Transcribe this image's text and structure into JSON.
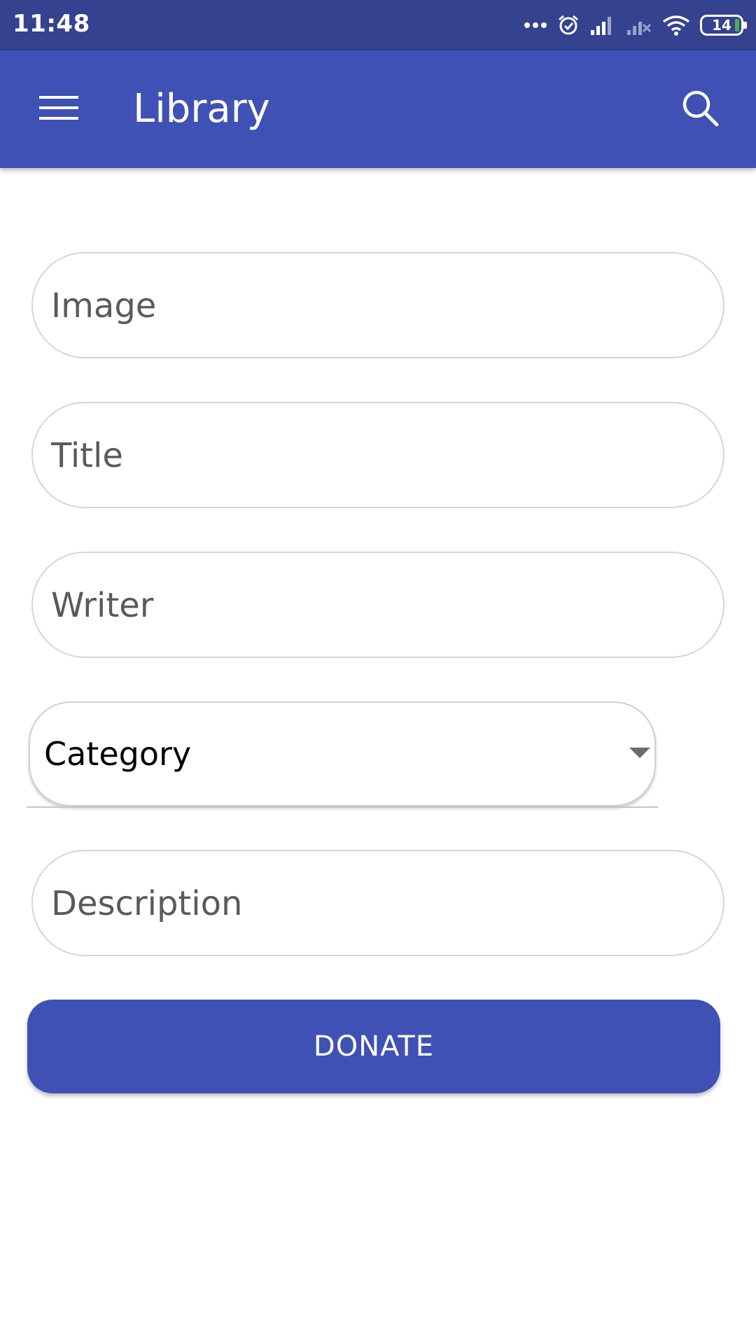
{
  "status_bar": {
    "time": "11:48",
    "battery_level": "14",
    "icons": [
      "more-dots-icon",
      "alarm-icon",
      "signal-icon",
      "signal-no-service-icon",
      "wifi-icon",
      "battery-icon"
    ]
  },
  "app_bar": {
    "title": "Library",
    "menu_icon": "hamburger-menu-icon",
    "search_icon": "search-icon",
    "color": "#3f51b5",
    "status_color": "#34428f"
  },
  "form": {
    "image_placeholder": "Image",
    "title_placeholder": "Title",
    "writer_placeholder": "Writer",
    "category_selected": "Category",
    "description_placeholder": "Description"
  },
  "actions": {
    "donate_label": "DONATE"
  }
}
